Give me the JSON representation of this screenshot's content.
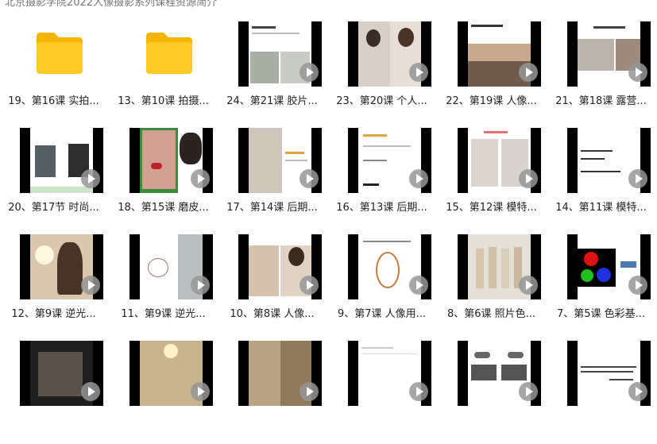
{
  "breadcrumb": "北京摄影学院2022人像摄影系列课程资源简介",
  "items": [
    {
      "label": "19、第16课 实拍...",
      "type": "folder"
    },
    {
      "label": "13、第10课 拍摄...",
      "type": "folder"
    },
    {
      "label": "24、第21课 胶片...",
      "type": "video"
    },
    {
      "label": "23、第20课 个人...",
      "type": "video"
    },
    {
      "label": "22、第19课 人像...",
      "type": "video"
    },
    {
      "label": "21、第18课 露营...",
      "type": "video"
    },
    {
      "label": "20、第17节 时尚...",
      "type": "video"
    },
    {
      "label": "18、第15课 磨皮...",
      "type": "video"
    },
    {
      "label": "17、第14课 后期...",
      "type": "video"
    },
    {
      "label": "16、第13课 后期...",
      "type": "video"
    },
    {
      "label": "15、第12课 模特...",
      "type": "video"
    },
    {
      "label": "14、第11课 模特...",
      "type": "video"
    },
    {
      "label": "12、第9课 逆光...",
      "type": "video"
    },
    {
      "label": "11、第9课 逆光...",
      "type": "video"
    },
    {
      "label": "10、第8课 人像...",
      "type": "video"
    },
    {
      "label": "9、第7课 人像用...",
      "type": "video"
    },
    {
      "label": "8、第6课 照片色...",
      "type": "video"
    },
    {
      "label": "7、第5课 色彩基...",
      "type": "video"
    },
    {
      "label": "",
      "type": "video"
    },
    {
      "label": "",
      "type": "video"
    },
    {
      "label": "",
      "type": "video"
    },
    {
      "label": "",
      "type": "video"
    },
    {
      "label": "",
      "type": "video"
    },
    {
      "label": "",
      "type": "video"
    }
  ]
}
